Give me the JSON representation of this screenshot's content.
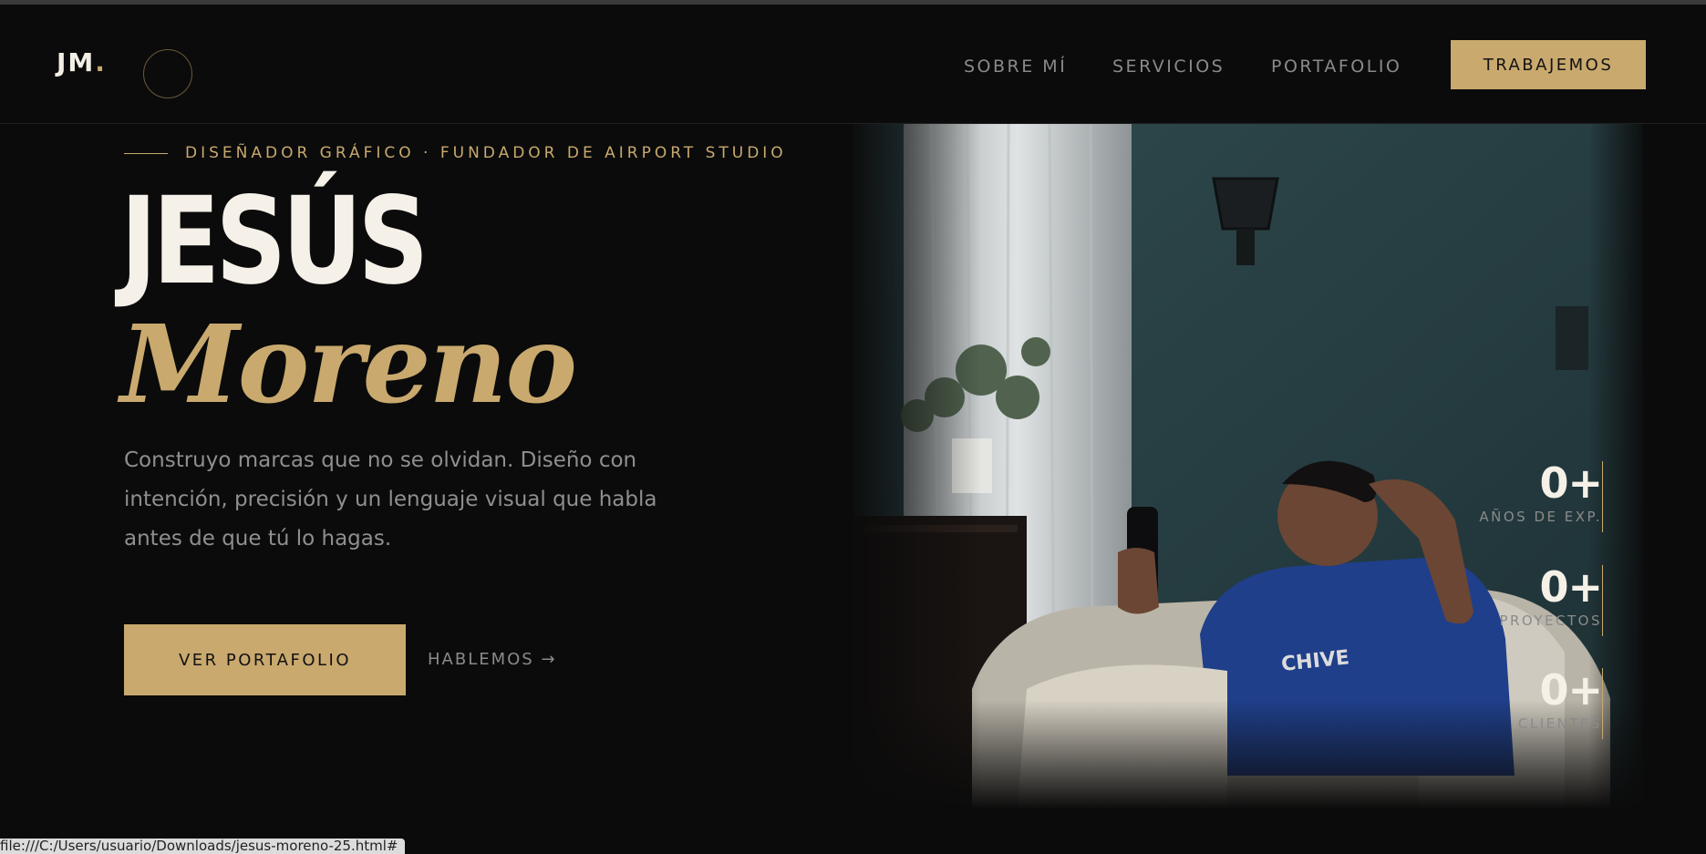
{
  "header": {
    "logo_text": "JM",
    "logo_dot": ".",
    "nav": [
      "SOBRE MÍ",
      "SERVICIOS",
      "PORTAFOLIO"
    ],
    "cta_label": "TRABAJEMOS"
  },
  "hero": {
    "eyebrow": "DISEÑADOR GRÁFICO · FUNDADOR DE AIRPORT STUDIO",
    "first_name": "JESÚS",
    "last_name": "Moreno",
    "description": "Construyo marcas que no se olvidan. Diseño con intención, precisión y un lenguaje visual que habla antes de que tú lo hagas.",
    "primary_button": "VER PORTAFOLIO",
    "secondary_button": "HABLEMOS →"
  },
  "stats": [
    {
      "value": "0+",
      "label": "AÑOS DE EXP."
    },
    {
      "value": "0+",
      "label": "PROYECTOS"
    },
    {
      "value": "0+",
      "label": "CLIENTES"
    }
  ],
  "statusbar": {
    "url": "file:///C:/Users/usuario/Downloads/jesus-moreno-25.html#"
  },
  "colors": {
    "background": "#0b0b0b",
    "accent_gold": "#c9a96e",
    "text_light": "#f5f0e8",
    "text_muted": "#8f8f8f"
  },
  "icons": {
    "circle_button": "circle-outline-icon"
  }
}
